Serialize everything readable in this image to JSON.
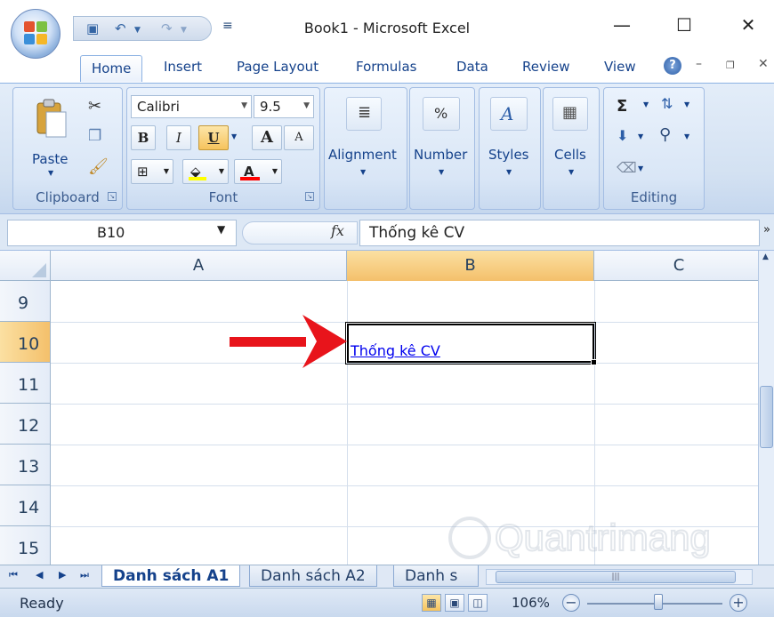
{
  "window": {
    "title": "Book1 - Microsoft Excel",
    "minimize_icon": "minimize-icon",
    "maximize_icon": "maximize-icon",
    "close_icon": "close-icon"
  },
  "qat": {
    "save_icon": "save-icon",
    "undo_icon": "undo-icon",
    "redo_icon": "redo-icon",
    "customize_icon": "customize-icon"
  },
  "tabs": [
    {
      "label": "Home",
      "active": true
    },
    {
      "label": "Insert"
    },
    {
      "label": "Page Layout"
    },
    {
      "label": "Formulas"
    },
    {
      "label": "Data"
    },
    {
      "label": "Review"
    },
    {
      "label": "View"
    }
  ],
  "ribbon": {
    "clipboard": {
      "label": "Clipboard",
      "paste": "Paste",
      "cut_icon": "scissors-icon",
      "copy_icon": "copy-icon",
      "format_painter_icon": "brush-icon"
    },
    "font": {
      "label": "Font",
      "font_name": "Calibri",
      "font_size": "9.5",
      "bold": "B",
      "italic": "I",
      "underline": "U",
      "grow": "A",
      "shrink": "A",
      "font_color_letter": "A",
      "border_icon": "border-icon",
      "fill_icon": "fill-color-icon"
    },
    "alignment": {
      "label": "Alignment"
    },
    "number": {
      "label": "Number",
      "symbol": "%"
    },
    "styles": {
      "label": "Styles"
    },
    "cells": {
      "label": "Cells"
    },
    "editing": {
      "label": "Editing",
      "sum": "Σ"
    }
  },
  "formula_bar": {
    "name_box": "B10",
    "fx": "fx",
    "formula": "Thống kê CV"
  },
  "columns": [
    "A",
    "B",
    "C"
  ],
  "selected_column": "B",
  "rows": [
    "9",
    "10",
    "11",
    "12",
    "13",
    "14",
    "15"
  ],
  "selected_row": "10",
  "cells": {
    "B10": "Thống kê CV"
  },
  "sheets": [
    {
      "label": "Danh sách A1",
      "active": true
    },
    {
      "label": "Danh sách A2"
    },
    {
      "label": "Danh s"
    }
  ],
  "status": {
    "text": "Ready",
    "zoom": "106%"
  },
  "watermark": "Quantrimang",
  "colors": {
    "accent": "#15428b",
    "selected_header": "#f4c06b",
    "arrow": "#e8141b",
    "link": "#0000ee"
  }
}
